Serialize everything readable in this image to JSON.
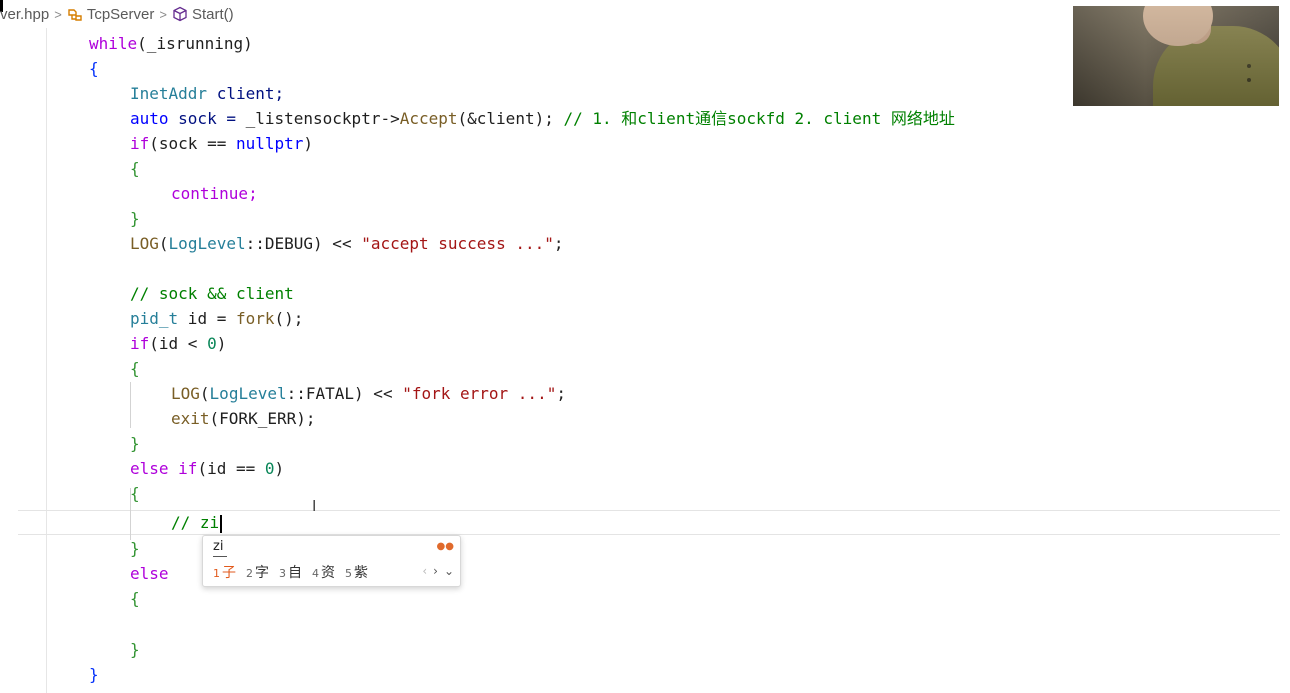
{
  "breadcrumb": {
    "file": "ver.hpp",
    "class": "TcpServer",
    "method": "Start()",
    "class_icon": "class-icon",
    "method_icon": "method-cube-icon"
  },
  "code": {
    "l1_a": "while",
    "l1_b": "(_isrunning)",
    "l2": "{",
    "l3_a": "InetAddr",
    "l3_b": " client;",
    "l4_a": "auto",
    "l4_b": " sock = ",
    "l4_c": "_listensockptr->",
    "l4_d": "Accept",
    "l4_e": "(&client); ",
    "l4_f": "// 1. 和client通信sockfd 2. client 网络地址",
    "l5_a": "if",
    "l5_b": "(sock == ",
    "l5_c": "nullptr",
    "l5_d": ")",
    "l6": "{",
    "l7": "continue;",
    "l8": "}",
    "l9_a": "LOG",
    "l9_b": "(",
    "l9_c": "LogLevel",
    "l9_d": "::DEBUG) << ",
    "l9_e": "\"accept success ...\"",
    "l9_f": ";",
    "l11": "// sock && client",
    "l12_a": "pid_t",
    "l12_b": " id = ",
    "l12_c": "fork",
    "l12_d": "();",
    "l13_a": "if",
    "l13_b": "(id < ",
    "l13_c": "0",
    "l13_d": ")",
    "l14": "{",
    "l15_a": "LOG",
    "l15_b": "(",
    "l15_c": "LogLevel",
    "l15_d": "::FATAL) << ",
    "l15_e": "\"fork error ...\"",
    "l15_f": ";",
    "l16_a": "exit",
    "l16_b": "(FORK_ERR);",
    "l17": "}",
    "l18_a": "else if",
    "l18_b": "(id == ",
    "l18_c": "0",
    "l18_d": ")",
    "l19": "{",
    "l20": "// zi",
    "l21": "}",
    "l22": "else",
    "l23": "{",
    "l25": "}",
    "l26": "}"
  },
  "ime": {
    "composition": "zi",
    "candidates": [
      {
        "num": "1",
        "text": "子"
      },
      {
        "num": "2",
        "text": "字"
      },
      {
        "num": "3",
        "text": "自"
      },
      {
        "num": "4",
        "text": "资"
      },
      {
        "num": "5",
        "text": "紫"
      }
    ],
    "nav_prev": "‹",
    "nav_next": "›",
    "nav_expand": "⌄"
  },
  "colors": {
    "keyword": "#0000ff",
    "control": "#af00db",
    "type": "#267f99",
    "function": "#795e26",
    "string": "#a31515",
    "number": "#098658",
    "comment": "#008000"
  }
}
